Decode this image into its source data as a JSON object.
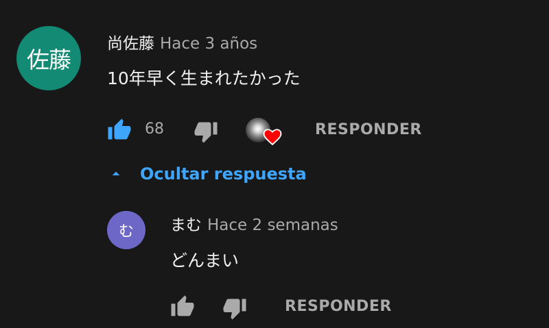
{
  "comment": {
    "avatar_text": "佐藤",
    "author": "尚佐藤",
    "time": "Hace 3 años",
    "text": "10年早く生まれたかった",
    "like_count": "68",
    "reply_label": "RESPONDER",
    "creator_heart": true
  },
  "replies_toggle": {
    "label": "Ocultar respuesta"
  },
  "reply": {
    "avatar_text": "む",
    "author": "まむ",
    "time": "Hace 2 semanas",
    "text": "どんまい",
    "reply_label": "RESPONDER"
  },
  "colors": {
    "background": "#181818",
    "link_blue": "#3ea6ff",
    "avatar_main": "#138a73",
    "avatar_reply": "#6d67c7",
    "heart_red": "#ff0000"
  }
}
